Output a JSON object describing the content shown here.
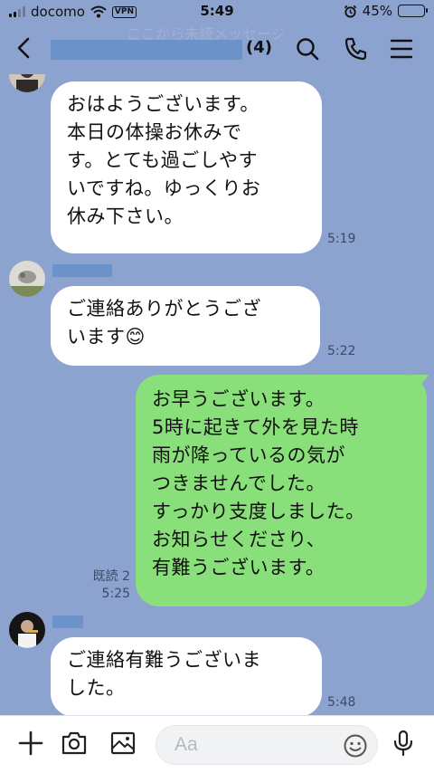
{
  "status_bar": {
    "carrier": "docomo",
    "vpn": "VPN",
    "time": "5:49",
    "battery": "45%",
    "battery_level": 0.45
  },
  "header": {
    "member_count": "(4)",
    "watermark": "ここから未読メッセージ"
  },
  "messages": [
    {
      "direction": "in",
      "text": "おはようございます。\n本日の体操お休みで\nす。とても過ごしやす\nいですね。ゆっくりお\n休み下さい。",
      "time": "5:19"
    },
    {
      "direction": "in",
      "text": "ご連絡ありがとうござ\nいます",
      "emoji": "😊",
      "time": "5:22"
    },
    {
      "direction": "out",
      "text": "お早うございます。\n5時に起きて外を見た時\n雨が降っているの気が\nつきませんでした。\nすっかり支度しました。\nお知らせくださり、\n有難うございます。",
      "read": "既読 2",
      "time": "5:25"
    },
    {
      "direction": "in",
      "text": "ご連絡有難うございま\nした。",
      "time": "5:48"
    }
  ],
  "input": {
    "placeholder": "Aa"
  },
  "colors": {
    "background": "#8da3cf",
    "outgoing_bubble": "#89df79",
    "incoming_bubble": "#ffffff",
    "name_mask": "#6b93c9"
  },
  "icons": [
    "back-icon",
    "search-icon",
    "phone-icon",
    "menu-icon",
    "plus-icon",
    "camera-icon",
    "image-icon",
    "emoji-icon",
    "mic-icon"
  ]
}
